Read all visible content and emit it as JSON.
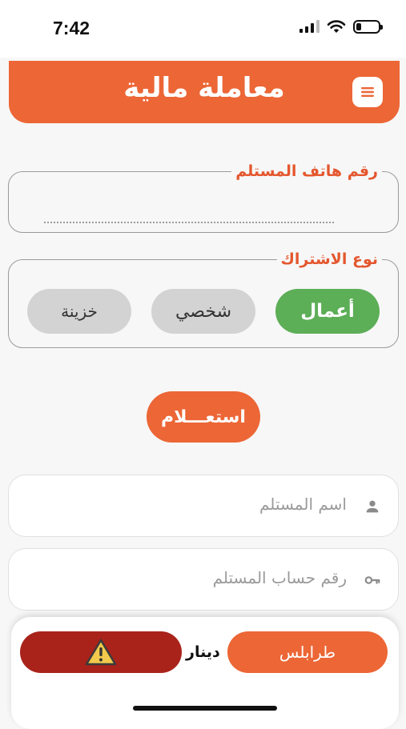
{
  "status_bar": {
    "time": "7:42"
  },
  "header": {
    "title": "معاملة مالية",
    "menu_icon": "menu-icon"
  },
  "phone_field": {
    "label": "رقم هاتف المستلم",
    "value": ""
  },
  "subscription": {
    "label": "نوع الاشتراك",
    "options": [
      {
        "label": "أعمال",
        "selected": true
      },
      {
        "label": "شخصي",
        "selected": false
      },
      {
        "label": "خزينة",
        "selected": false
      }
    ]
  },
  "inquiry_button": {
    "label": "استعـــلام"
  },
  "recipient_name": {
    "placeholder": "اسم المستلم",
    "icon": "person-icon"
  },
  "recipient_account": {
    "placeholder": "رقم حساب المستلم",
    "icon": "key-icon"
  },
  "footer": {
    "city": "طرابلس",
    "currency": "دينار",
    "warning_icon": "warning-icon"
  },
  "colors": {
    "primary": "#ec6636",
    "success": "#5cae57",
    "danger": "#a9231b",
    "chip_inactive": "#d3d3d3"
  }
}
